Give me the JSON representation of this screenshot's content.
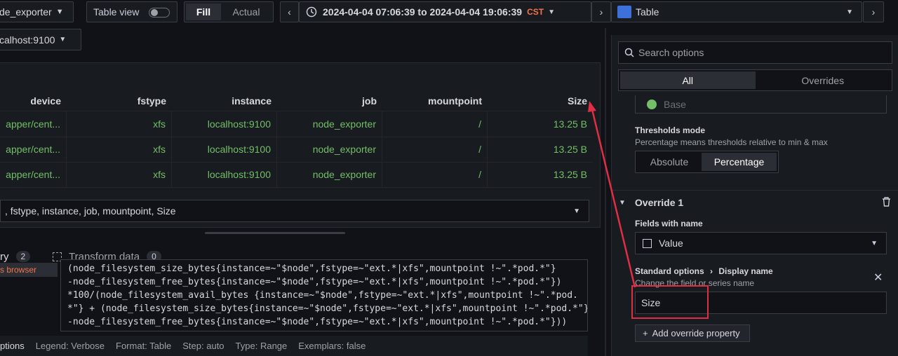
{
  "topbar": {
    "datasource_label": "de_exporter",
    "table_view_label": "Table view",
    "fill_label": "Fill",
    "actual_label": "Actual",
    "time_range": "2024-04-04 07:06:39 to 2024-04-04 19:06:39",
    "timezone": "CST",
    "visualization_label": "Table"
  },
  "instance_var": "calhost:9100",
  "table": {
    "headers": [
      "device",
      "fstype",
      "instance",
      "job",
      "mountpoint",
      "Size"
    ],
    "rows": [
      [
        "apper/cent...",
        "xfs",
        "localhost:9100",
        "node_exporter",
        "/",
        "13.25 B"
      ],
      [
        "apper/cent...",
        "xfs",
        "localhost:9100",
        "node_exporter",
        "/",
        "13.25 B"
      ],
      [
        "apper/cent...",
        "xfs",
        "localhost:9100",
        "node_exporter",
        "/",
        "13.25 B"
      ]
    ],
    "fields_select": ", fstype, instance, job, mountpoint, Size"
  },
  "query_tabs": {
    "query_label": "ry",
    "query_count": "2",
    "transform_label": "Transform data",
    "transform_count": "0",
    "metrics_browser": "s browser"
  },
  "query_lines": [
    "(node_filesystem_size_bytes{instance=~\"$node\",fstype=~\"ext.*|xfs\",mountpoint !~\".*pod.*\"}",
    "-node_filesystem_free_bytes{instance=~\"$node\",fstype=~\"ext.*|xfs\",mountpoint !~\".*pod.*\"})",
    "*100/(node_filesystem_avail_bytes {instance=~\"$node\",fstype=~\"ext.*|xfs\",mountpoint !~\".*pod.",
    "*\"} + (node_filesystem_size_bytes{instance=~\"$node\",fstype=~\"ext.*|xfs\",mountpoint !~\".*pod.*\"}",
    "-node_filesystem_free_bytes{instance=~\"$node\",fstype=~\"ext.*|xfs\",mountpoint !~\".*pod.*\"}))"
  ],
  "query_options": {
    "options": "ptions",
    "legend": "Legend: Verbose",
    "format": "Format: Table",
    "step": "Step: auto",
    "type": "Type: Range",
    "exemplars": "Exemplars: false"
  },
  "options_pane": {
    "search_placeholder": "Search options",
    "tab_all": "All",
    "tab_overrides": "Overrides",
    "base_label": "Base",
    "thresholds_mode_title": "Thresholds mode",
    "thresholds_mode_desc": "Percentage means thresholds relative to min & max",
    "absolute_label": "Absolute",
    "percentage_label": "Percentage",
    "override_title": "Override 1",
    "fields_with_name_label": "Fields with name",
    "field_value": "Value",
    "standard_options": "Standard options",
    "display_name": "Display name",
    "display_name_desc": "Change the field or series name",
    "display_name_value": "Size",
    "add_override_label": "Add override property"
  },
  "colors": {
    "accent_green": "#73bf69",
    "annotation_red": "#e02f44",
    "tab_underline": "#f55f3e"
  }
}
